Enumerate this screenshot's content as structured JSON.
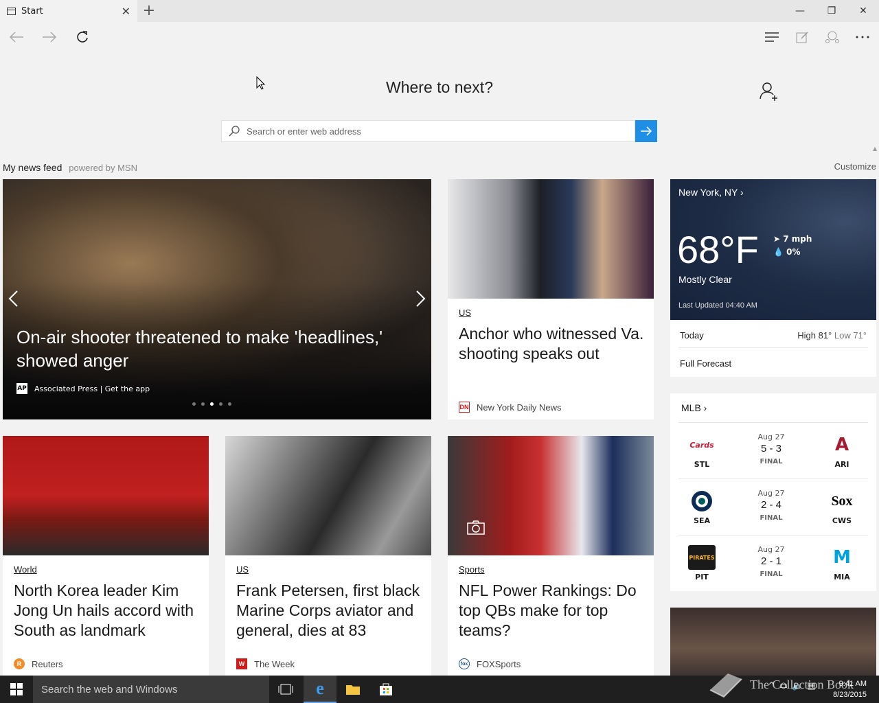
{
  "browser": {
    "tab_title": "Start",
    "close_tab": "✕",
    "new_tab": "+"
  },
  "window": {
    "minimize": "—",
    "restore": "❐",
    "close": "✕"
  },
  "home": {
    "heading": "Where to next?",
    "search_placeholder": "Search or enter web address",
    "feed_title": "My news feed",
    "feed_powered": "powered by MSN",
    "customize": "Customize"
  },
  "hero": {
    "headline": "On-air shooter threatened to make 'headlines,' showed anger",
    "source_logo": "AP",
    "source": "Associated Press | Get the app",
    "dots": 5,
    "active_dot": 2
  },
  "cards": [
    {
      "category": "US",
      "title": "Anchor who witnessed Va. shooting speaks out",
      "source": "New York Daily News",
      "logo": "DN",
      "logo_color": "#d11b1b"
    },
    {
      "category": "World",
      "title": "North Korea leader Kim Jong Un hails accord with South as landmark",
      "source": "Reuters",
      "logo": "R",
      "logo_color": "#f28c28"
    },
    {
      "category": "US",
      "title": "Frank Petersen, first black Marine Corps aviator and general, dies at 83",
      "source": "The Week",
      "logo": "W",
      "logo_color": "#d11b1b"
    },
    {
      "category": "Sports",
      "title": "NFL Power Rankings: Do top QBs make for top teams?",
      "source": "FOXSports",
      "logo": "fox",
      "logo_color": "#1a4f8b"
    }
  ],
  "weather": {
    "city": "New York, NY",
    "temp": "68°F",
    "wind": "7 mph",
    "precip": "0%",
    "condition": "Mostly Clear",
    "updated": "Last Updated 04:40 AM",
    "today_label": "Today",
    "today_high": "High 81°",
    "today_low": "Low 71°",
    "forecast": "Full Forecast"
  },
  "mlb": {
    "title": "MLB",
    "games": [
      {
        "date": "Aug 27",
        "score": "5 - 3",
        "status": "FINAL",
        "home": "STL",
        "away": "ARI",
        "home_color": "#c41e3a",
        "away_color": "#a71930"
      },
      {
        "date": "Aug 27",
        "score": "2 - 4",
        "status": "FINAL",
        "home": "SEA",
        "away": "CWS",
        "home_color": "#0c2c56",
        "away_color": "#000000"
      },
      {
        "date": "Aug 27",
        "score": "2 - 1",
        "status": "FINAL",
        "home": "PIT",
        "away": "MIA",
        "home_color": "#fdb827",
        "away_color": "#00a3e0"
      }
    ]
  },
  "taskbar": {
    "search_placeholder": "Search the web and Windows",
    "time": "9:41 AM",
    "date": "8/23/2015",
    "watermark": "The Collection Book"
  }
}
